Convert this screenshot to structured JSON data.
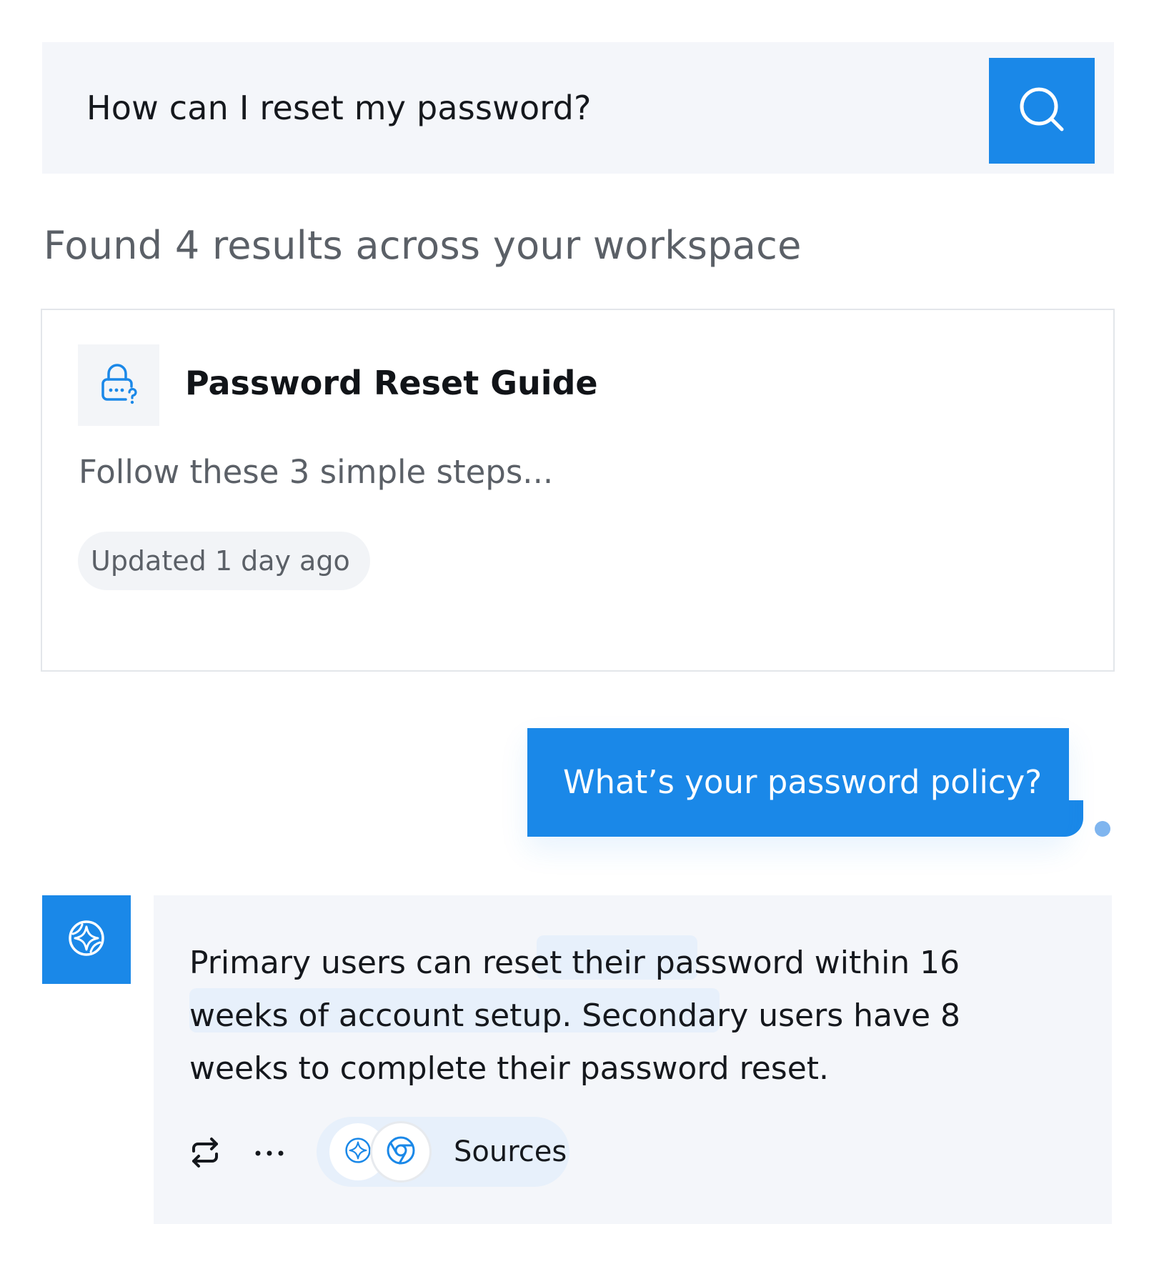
{
  "search": {
    "query": "How can I reset my password?"
  },
  "results": {
    "summary": "Found 4 results across your workspace"
  },
  "result_card": {
    "title": "Password Reset Guide",
    "snippet": "Follow these 3 simple steps...",
    "updated": "Updated 1 day ago",
    "icon": "lock-question-icon"
  },
  "chat": {
    "user_message": "What’s your password policy?",
    "assistant_message": "Primary users can reset their password within 16 weeks of account setup. Secondary users have 8 weeks to complete their password reset.",
    "actions": {
      "sources_label": "Sources"
    }
  },
  "colors": {
    "accent": "#1a88e8",
    "panel": "#f4f6fa",
    "highlight": "#e7f0fb"
  }
}
